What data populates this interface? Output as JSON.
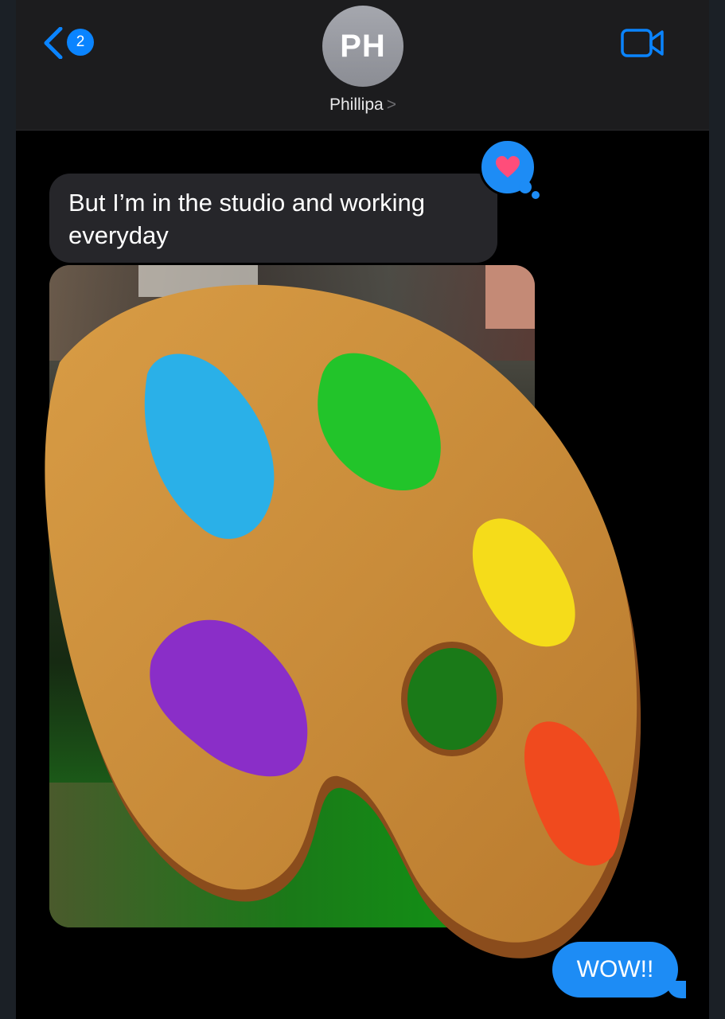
{
  "header": {
    "unread_count": "2",
    "avatar_initials": "PH",
    "contact_name": "Phillipa",
    "chevron": ">"
  },
  "messages": [
    {
      "direction": "incoming",
      "text": "But I’m in the studio and working everyday",
      "reaction": "heart"
    },
    {
      "direction": "incoming",
      "type": "photo",
      "sticker": "artist-palette-emoji"
    },
    {
      "direction": "outgoing",
      "text": "WOW!!"
    }
  ],
  "colors": {
    "accent": "#0a84ff",
    "incoming_bubble": "#26262a",
    "outgoing_bubble": "#1d8cf5",
    "heart": "#ff4d7a"
  }
}
